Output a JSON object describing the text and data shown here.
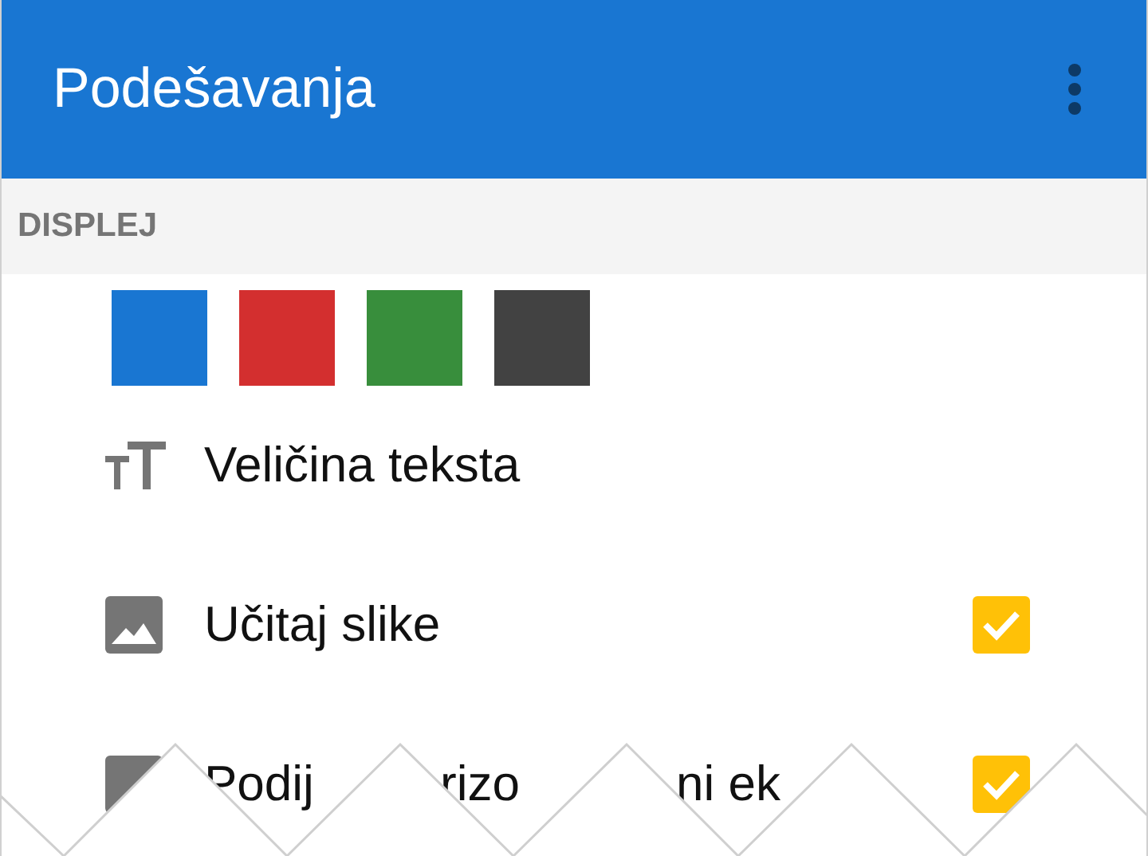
{
  "app_bar": {
    "title": "Podešavanja"
  },
  "section": {
    "title": "DISPLEJ"
  },
  "color_swatches": [
    {
      "color": "#1976d2"
    },
    {
      "color": "#d32f2f"
    },
    {
      "color": "#388e3c"
    },
    {
      "color": "#424242"
    }
  ],
  "settings": [
    {
      "label": "Veličina teksta",
      "kind": "plain"
    },
    {
      "label": "Učitaj slike",
      "kind": "checkbox",
      "checked": true
    },
    {
      "label_parts": [
        "Podij",
        "rizo",
        "ni ek"
      ],
      "kind": "checkbox",
      "checked": true
    }
  ]
}
